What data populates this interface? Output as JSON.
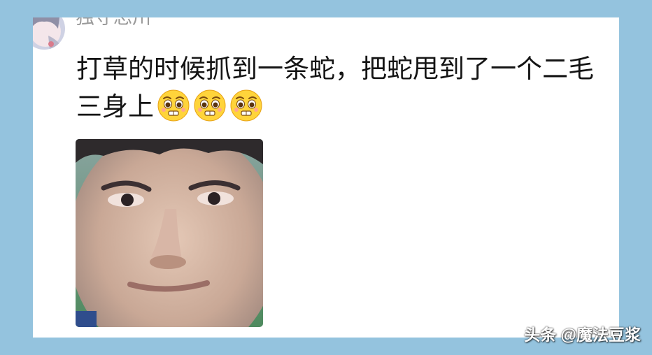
{
  "comment": {
    "username": "独守忘川",
    "text": "打草的时候抓到一条蛇，把蛇甩到了一个二毛三身上",
    "emoji_count": 3,
    "emoji_name": "pleading-face-emoji"
  },
  "watermark": "头条 @魔法豆浆",
  "colors": {
    "background": "#94c3de",
    "card": "#ffffff",
    "username": "#9a9a9a",
    "text": "#141414"
  }
}
